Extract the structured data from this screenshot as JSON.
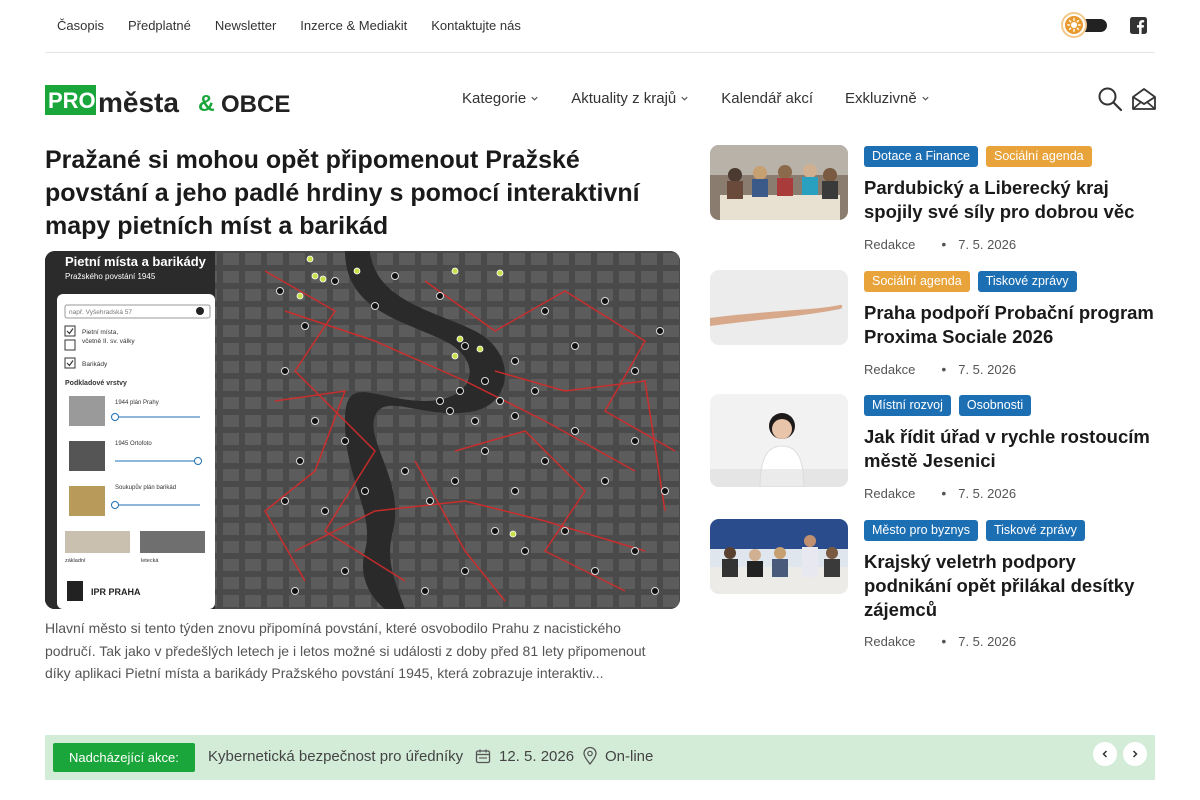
{
  "topbar": {
    "links": [
      "Časopis",
      "Předplatné",
      "Newsletter",
      "Inzerce & Mediakit",
      "Kontaktujte nás"
    ]
  },
  "header": {
    "logo_pro": "PRO",
    "logo_mesta": "města",
    "logo_amp": "&",
    "logo_obce": "OBCE",
    "nav": [
      {
        "label": "Kategorie",
        "dropdown": true
      },
      {
        "label": "Aktuality z krajů",
        "dropdown": true
      },
      {
        "label": "Kalendář akcí",
        "dropdown": false
      },
      {
        "label": "Exkluzivně",
        "dropdown": true
      }
    ]
  },
  "main_article": {
    "title": "Pražané si mohou opět připomenout Pražské povstání a jeho padlé hrdiny s pomocí interaktivní mapy pietních míst a barikád",
    "excerpt": "Hlavní město si tento týden znovu připomíná povstání, které osvobodilo Prahu z nacistického područí. Tak jako v předešlých letech je i letos možné si události z doby před 81 lety připomenout díky aplikaci Pietní místa a barikády Pražského povstání 1945, která zobrazuje interaktiv...",
    "image": {
      "title": "Pietní místa a barikády",
      "subtitle": "Pražského povstání 1945",
      "search_placeholder": "např. Vyšehradská 57",
      "layers": [
        "Pietní místa,",
        "včetně II. sv. války",
        "Barikády"
      ],
      "base_layers_title": "Podkladové vrstvy",
      "base_layers": [
        "1944 plán Prahy",
        "1945 Ortofoto",
        "Soukupův plán barikád"
      ],
      "base_maps": [
        "základní",
        "letecká"
      ],
      "brand": "IPR PRAHA"
    }
  },
  "side_articles": [
    {
      "tags": [
        {
          "label": "Dotace a Finance",
          "color": "#1d6fb3"
        },
        {
          "label": "Sociální agenda",
          "color": "#e8a33a"
        }
      ],
      "title": "Pardubický a Liberecký kraj spojily své síly pro dobrou věc",
      "author": "Redakce",
      "date": "7. 5. 2026"
    },
    {
      "tags": [
        {
          "label": "Sociální agenda",
          "color": "#e8a33a"
        },
        {
          "label": "Tiskové zprávy",
          "color": "#1d6fb3"
        }
      ],
      "title": "Praha podpoří Probační program Proxima Sociale 2026",
      "author": "Redakce",
      "date": "7. 5. 2026"
    },
    {
      "tags": [
        {
          "label": "Místní rozvoj",
          "color": "#1d6fb3"
        },
        {
          "label": "Osobnosti",
          "color": "#1d6fb3"
        }
      ],
      "title": "Jak řídit úřad v rychle rostoucím městě Jesenici",
      "author": "Redakce",
      "date": "7. 5. 2026"
    },
    {
      "tags": [
        {
          "label": "Město pro byznys",
          "color": "#1d6fb3"
        },
        {
          "label": "Tiskové zprávy",
          "color": "#1d6fb3"
        }
      ],
      "title": "Krajský veletrh podpory podnikání opět přilákal desítky zájemců",
      "author": "Redakce",
      "date": "7. 5. 2026"
    }
  ],
  "events": {
    "label": "Nadcházející akce:",
    "name": "Kybernetická bezpečnost pro úředníky",
    "date": "12. 5. 2026",
    "place": "On-line"
  },
  "colors": {
    "brand_green": "#1aa63a",
    "tag_blue": "#1d6fb3",
    "tag_orange": "#e8a33a",
    "events_bg": "#d3ecd8"
  }
}
